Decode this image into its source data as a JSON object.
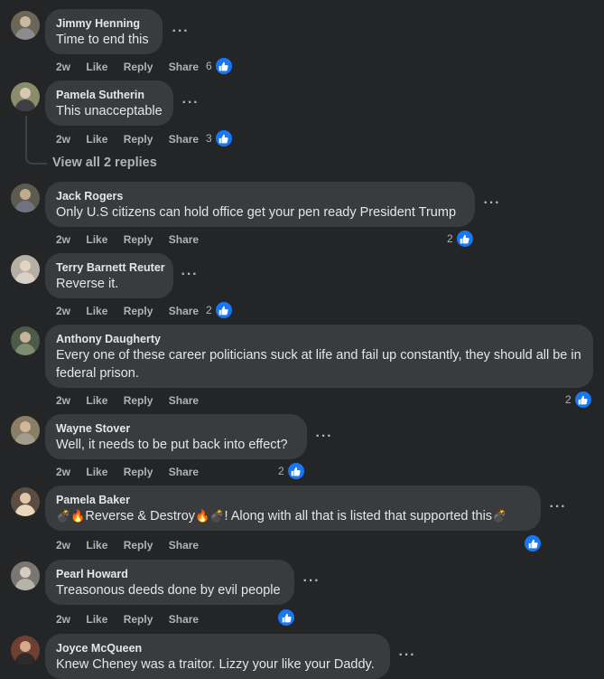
{
  "actions": {
    "like": "Like",
    "reply": "Reply",
    "share": "Share",
    "more": "···"
  },
  "view_replies": "View all 2 replies",
  "comments": [
    {
      "name": "Jimmy Henning",
      "text": "Time to end this",
      "time": "2w",
      "reactions": "6"
    },
    {
      "name": "Pamela Sutherin",
      "text": "This unacceptable",
      "time": "2w",
      "reactions": "3"
    },
    {
      "name": "Jack Rogers",
      "text": "Only U.S citizens can hold office get your pen ready President Trump",
      "time": "2w",
      "reactions": "2"
    },
    {
      "name": "Terry Barnett Reuter",
      "text": "Reverse it.",
      "time": "2w",
      "reactions": "2"
    },
    {
      "name": "Anthony Daugherty",
      "text": "Every one of these career politicians suck at life and fail up constantly, they should all be in federal prison.",
      "time": "2w",
      "reactions": "2"
    },
    {
      "name": "Wayne Stover",
      "text": "Well, it needs to be put back into effect?",
      "time": "2w",
      "reactions": "2"
    },
    {
      "name": "Pamela Baker",
      "text_parts": [
        "💣",
        "🔥",
        "Reverse & Destroy",
        "🔥",
        "💣",
        "! Along with all that is listed that supported this",
        "💣"
      ],
      "time": "2w",
      "reactions": ""
    },
    {
      "name": "Pearl Howard",
      "text": "Treasonous deeds done by evil people",
      "time": "2w",
      "reactions": ""
    },
    {
      "name": "Joyce McQueen",
      "text": "Knew Cheney was a traitor. Lizzy your like your Daddy.",
      "time": "",
      "reactions": ""
    }
  ],
  "colors": {
    "background": "#242526",
    "bubble": "#3a3b3c",
    "like_blue": "#1877f2",
    "muted": "#b0b3b8"
  },
  "icons": {
    "like": "thumbs-up-icon",
    "more": "more-options-icon"
  }
}
